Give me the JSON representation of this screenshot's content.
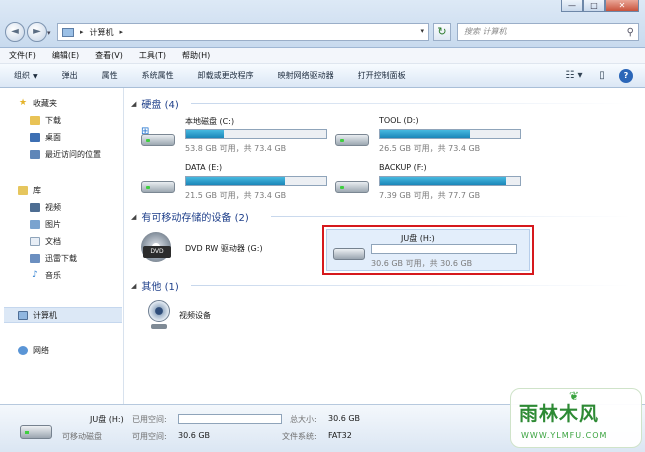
{
  "window": {
    "controls": {
      "minimize": "—",
      "maximize": "□",
      "close": "✕"
    }
  },
  "nav": {
    "back": "◄",
    "forward": "►",
    "recent": "▾"
  },
  "address": {
    "separator": "▸",
    "location": "计算机",
    "dropdown": "▾"
  },
  "refresh": "↻",
  "search": {
    "placeholder": "搜索 计算机",
    "icon": "⚲"
  },
  "menu": [
    "文件(F)",
    "编辑(E)",
    "查看(V)",
    "工具(T)",
    "帮助(H)"
  ],
  "toolbar": {
    "organize": "组织",
    "items": [
      "弹出",
      "属性",
      "系统属性",
      "卸载或更改程序",
      "映射网络驱动器",
      "打开控制面板"
    ],
    "view_icon": "☷ ▾",
    "preview_icon": "▯",
    "help_icon": "?"
  },
  "sidebar": {
    "favorites": "收藏夹",
    "favorites_items": [
      "下载",
      "桌面",
      "最近访问的位置"
    ],
    "libraries": "库",
    "library_items": [
      "视频",
      "图片",
      "文档",
      "迅雷下载",
      "音乐"
    ],
    "computer": "计算机",
    "network": "网络"
  },
  "groups": {
    "hard_disks": "硬盘 (4)",
    "removable": "有可移动存储的设备 (2)",
    "other": "其他 (1)"
  },
  "drives": [
    {
      "name": "本地磁盘 (C:)",
      "size": "53.8 GB 可用，共 73.4 GB",
      "used_fraction": 0.27
    },
    {
      "name": "TOOL (D:)",
      "size": "26.5 GB 可用，共 73.4 GB",
      "used_fraction": 0.64
    },
    {
      "name": "DATA (E:)",
      "size": "21.5 GB 可用，共 73.4 GB",
      "used_fraction": 0.71
    },
    {
      "name": "BACKUP (F:)",
      "size": "7.39 GB 可用，共 77.7 GB",
      "used_fraction": 0.9
    }
  ],
  "removable": {
    "dvd": {
      "name": "DVD RW 驱动器 (G:)",
      "badge": "DVD"
    },
    "usb": {
      "name": "JU盘 (H:)",
      "size": "30.6 GB 可用，共 30.6 GB",
      "used_fraction": 0.0
    }
  },
  "other": {
    "webcam": "视频设备"
  },
  "details": {
    "name": "JU盘 (H:)",
    "type": "可移动磁盘",
    "used_label": "已用空间:",
    "free_label": "可用空间:",
    "free_value": "30.6 GB",
    "total_label": "总大小:",
    "total_value": "30.6 GB",
    "fs_label": "文件系统:",
    "fs_value": "FAT32"
  },
  "watermark": {
    "brand": "雨林木风",
    "url": "WWW.YLMFU.COM"
  },
  "colors": {
    "selection_border": "#d6191d",
    "bar_fill": "#1b86b9",
    "group_header": "#1e3f8a"
  }
}
